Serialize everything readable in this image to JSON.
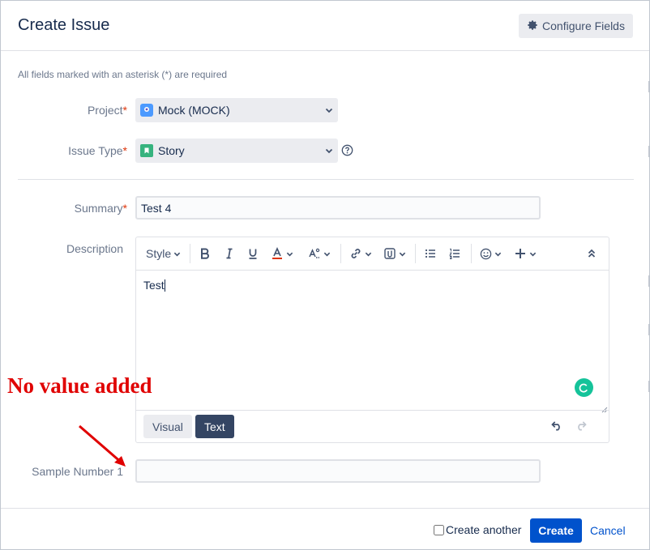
{
  "dialog": {
    "title": "Create Issue",
    "configure_fields_label": "Configure Fields",
    "required_note": "All fields marked with an asterisk (*) are required"
  },
  "fields": {
    "project": {
      "label": "Project",
      "asterisk": "*",
      "value": "Mock (MOCK)"
    },
    "issue_type": {
      "label": "Issue Type",
      "asterisk": "*",
      "value": "Story"
    },
    "summary": {
      "label": "Summary",
      "asterisk": "*",
      "value": "Test 4"
    },
    "description": {
      "label": "Description",
      "value": "Test"
    },
    "sample_number": {
      "label": "Sample Number 1",
      "value": ""
    }
  },
  "editor": {
    "style_label": "Style",
    "mode_visual": "Visual",
    "mode_text": "Text",
    "active_mode": "Text",
    "toolbar_icons": [
      "bold-icon",
      "italic-icon",
      "underline-icon",
      "text-color-icon",
      "text-format-icon",
      "link-icon",
      "attachment-icon",
      "bullet-list-icon",
      "numbered-list-icon",
      "emoji-icon",
      "insert-more-icon",
      "collapse-toolbar-icon"
    ]
  },
  "annotation": {
    "text": "No value added",
    "color": "#e00000"
  },
  "footer": {
    "create_another_label": "Create another",
    "create_another_checked": false,
    "create_label": "Create",
    "cancel_label": "Cancel"
  },
  "colors": {
    "primary": "#0052cc",
    "text_mode_bg": "#344563",
    "required": "#de350b",
    "grammarly": "#15c39a"
  }
}
